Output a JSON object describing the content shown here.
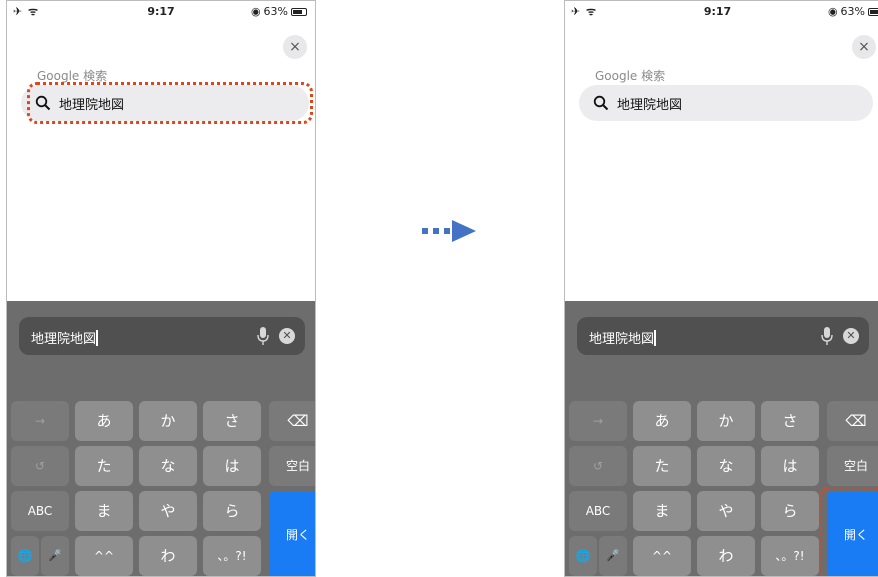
{
  "status": {
    "left_icons": "✈ ᯤ",
    "time": "9:17",
    "battery": "63%",
    "battery_icon": "◉"
  },
  "close_glyph": "×",
  "search": {
    "label": "Google 検索",
    "query": "地理院地図"
  },
  "input": {
    "text": "地理院地図"
  },
  "keyboard": {
    "row1": [
      "→",
      "あ",
      "か",
      "さ",
      "⌫"
    ],
    "row2": [
      "↺",
      "た",
      "な",
      "は",
      "空白"
    ],
    "row3": [
      "ABC",
      "ま",
      "や",
      "ら"
    ],
    "row4": [
      "🌐",
      "🎤",
      "^^",
      "わ",
      "、。?!"
    ],
    "go": "開く"
  },
  "colors": {
    "highlight": "#e0451a",
    "go_key": "#1a7cf5",
    "arrow": "#4472c4"
  }
}
